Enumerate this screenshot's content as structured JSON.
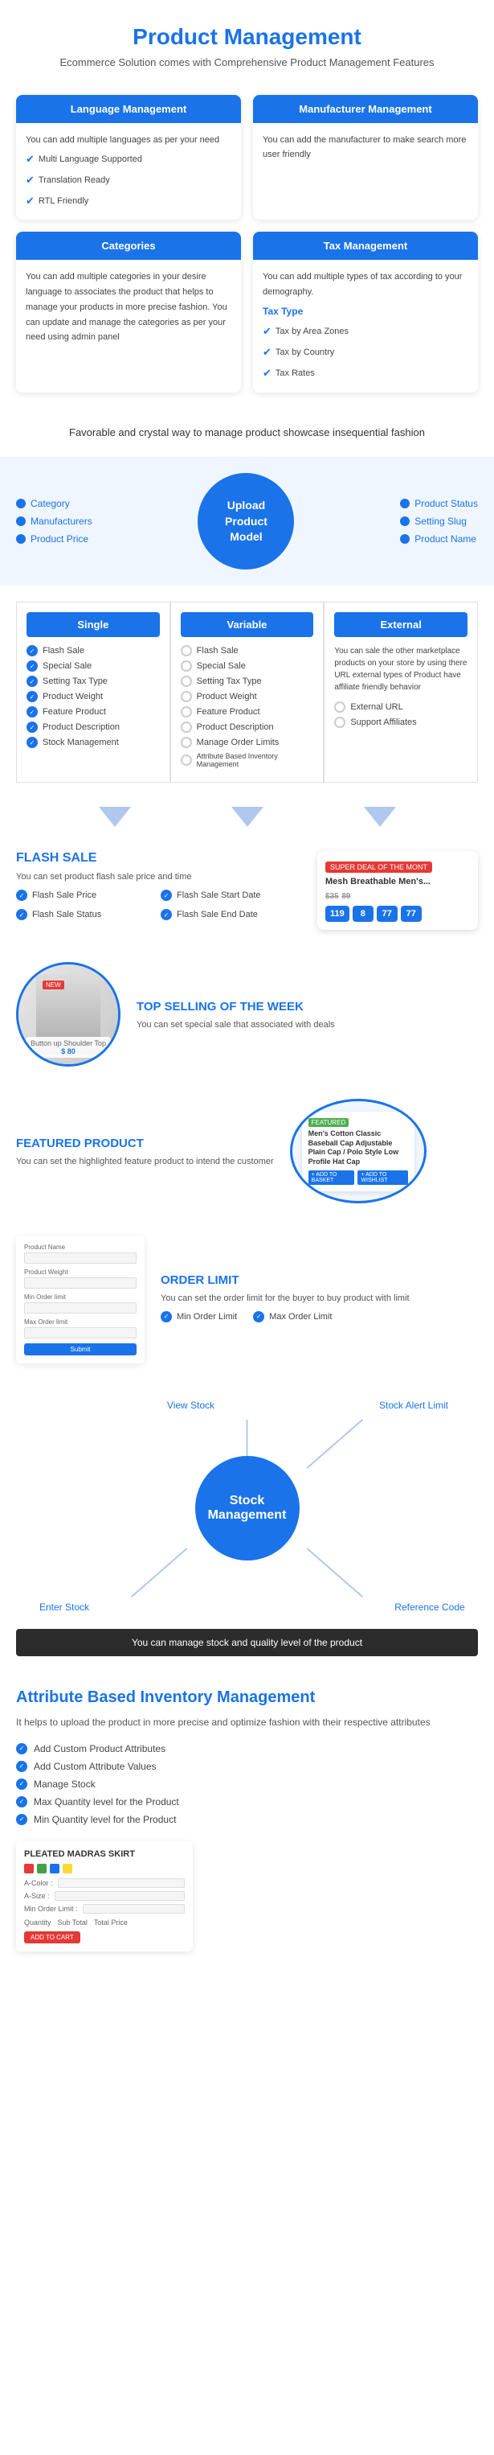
{
  "page": {
    "title": "Product Management",
    "subtitle": "Ecommerce Solution comes with Comprehensive Product Management Features"
  },
  "feature_cards": [
    {
      "header": "Language Management",
      "body": "You can add multiple languages as per your need",
      "items": [
        "Multi Language Supported",
        "Translation Ready",
        "RTL Friendly"
      ]
    },
    {
      "header": "Manufacturer Management",
      "body": "You can add the manufacturer to make search more user friendly",
      "items": []
    },
    {
      "header": "Categories",
      "body": "You can add multiple categories in your desire language to associates the product that helps to manage your products in more precise fashion. You can update and manage the categories as per your need using admin panel",
      "items": []
    },
    {
      "header": "Tax Management",
      "body": "You can add multiple types of tax according to your demography.",
      "tax_type": "Tax Type",
      "items": [
        "Tax by Area Zones",
        "Tax by Country",
        "Tax Rates"
      ]
    }
  ],
  "tagline": "Favorable and crystal way to manage product showcase\ninsequential fashion",
  "upload_model": {
    "title": "Upload\nProduct\nModel",
    "left_items": [
      "Category",
      "Manufacturers",
      "Product Price"
    ],
    "right_items": [
      "Product Status",
      "Setting Slug",
      "Product Name"
    ]
  },
  "product_types": {
    "single": {
      "label": "Single",
      "items_checked": [
        "Flash Sale",
        "Special Sale",
        "Setting Tax Type",
        "Product Weight",
        "Feature Product",
        "Product Description",
        "Stock Management"
      ],
      "items_unchecked": []
    },
    "variable": {
      "label": "Variable",
      "items_checked": [],
      "items_unchecked": [
        "Flash Sale",
        "Special Sale",
        "Setting Tax Type",
        "Product Weight",
        "Feature Product",
        "Product Description",
        "Manage Order Limits",
        "Attribute Based Inventory Management"
      ]
    },
    "external": {
      "label": "External",
      "body": "You can sale the other marketplace products on your store by using there URL external types of Product have affiliate friendly behavior",
      "items_unchecked": [
        "External URL",
        "Support Affiliates"
      ]
    }
  },
  "flash_sale": {
    "heading": "FLASH SALE",
    "description": "You can set product flash sale price and time",
    "features": [
      "Flash Sale Price",
      "Flash Sale Start Date",
      "Flash Sale Status",
      "Flash Sale End Date"
    ],
    "card": {
      "badge": "SUPER DEAL OF THE MONT",
      "title": "Mesh Breathable Men's...",
      "price": "$35",
      "original_price": "89",
      "timer": [
        "119",
        "8",
        "77",
        "77"
      ]
    }
  },
  "top_selling": {
    "heading": "TOP SELLING OF THE WEEK",
    "description": "You can set special sale that associated with deals",
    "product_tag": "NEW",
    "product_label": "Button up Shoulder Top",
    "product_price": "$ 80"
  },
  "featured": {
    "heading": "FEATURED PRODUCT",
    "description": "You can set the highlighted feature product to intend the customer",
    "card_badge": "FEATURED",
    "card_title": "Men's Cotton Classic Baseball Cap Adjustable Plain Cap / Polo Style Low Profile Hat Cap",
    "actions": [
      "+ ADD TO BASKET",
      "+ ADD TO WISHLIST"
    ]
  },
  "order_limit": {
    "heading": "ORDER LIMIT",
    "description": "You can set the order limit for the buyer to buy product with limit",
    "min_label": "Min Order Limit",
    "max_label": "Max Order Limit",
    "form_fields": [
      "Product Name",
      "Product Weight",
      "Min Order limit",
      "Max Order limit"
    ],
    "btn_label": "Submit"
  },
  "stock": {
    "heading": "Stock\nManagement",
    "center_label": "Stock\nManagement",
    "items": [
      "View Stock",
      "Stock Alert Limit",
      "Enter Stock",
      "Reference Code"
    ],
    "bottom_text": "You can manage stock and quality level of the product"
  },
  "attr_inventory": {
    "heading": "Attribute Based Inventory Management",
    "description": "It helps to upload the product in more precise and optimize fashion with their respective attributes",
    "features": [
      "Add Custom Product Attributes",
      "Add Custom Attribute Values",
      "Manage Stock",
      "Max Quantity level for the Product",
      "Min Quantity level for the Product"
    ],
    "card": {
      "title": "PLEATED MADRAS SKIRT",
      "fields": [
        "A-Color :",
        "A-Size :",
        "Min Order Limit :"
      ],
      "qty_label": "Quantity",
      "subtotal_label": "Sub Total",
      "total_label": "Total Price",
      "btn_label": "ADD TO CART"
    }
  }
}
